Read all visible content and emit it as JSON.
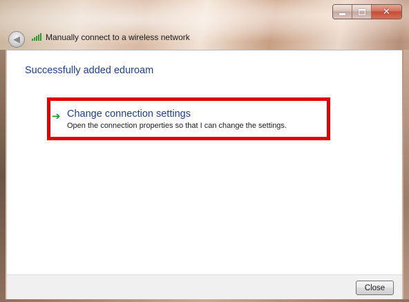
{
  "window": {
    "title": "Manually connect to a wireless network",
    "caption_buttons": {
      "minimize_icon": "minimize-icon",
      "maximize_icon": "maximize-icon",
      "close_icon": "close-icon",
      "close_glyph": "✕"
    },
    "back_icon": "back-arrow-icon",
    "back_glyph": "◀",
    "signal_icon": "wireless-signal-icon"
  },
  "content": {
    "heading": "Successfully added eduroam",
    "task": {
      "icon": "green-arrow-icon",
      "arrow_glyph": "➔",
      "title": "Change connection settings",
      "description": "Open the connection properties so that I can change the settings.",
      "highlight_color": "#e10000"
    }
  },
  "footer": {
    "close_label": "Close"
  },
  "colors": {
    "link_blue": "#1e3f8a",
    "arrow_green": "#1d9a2a"
  }
}
